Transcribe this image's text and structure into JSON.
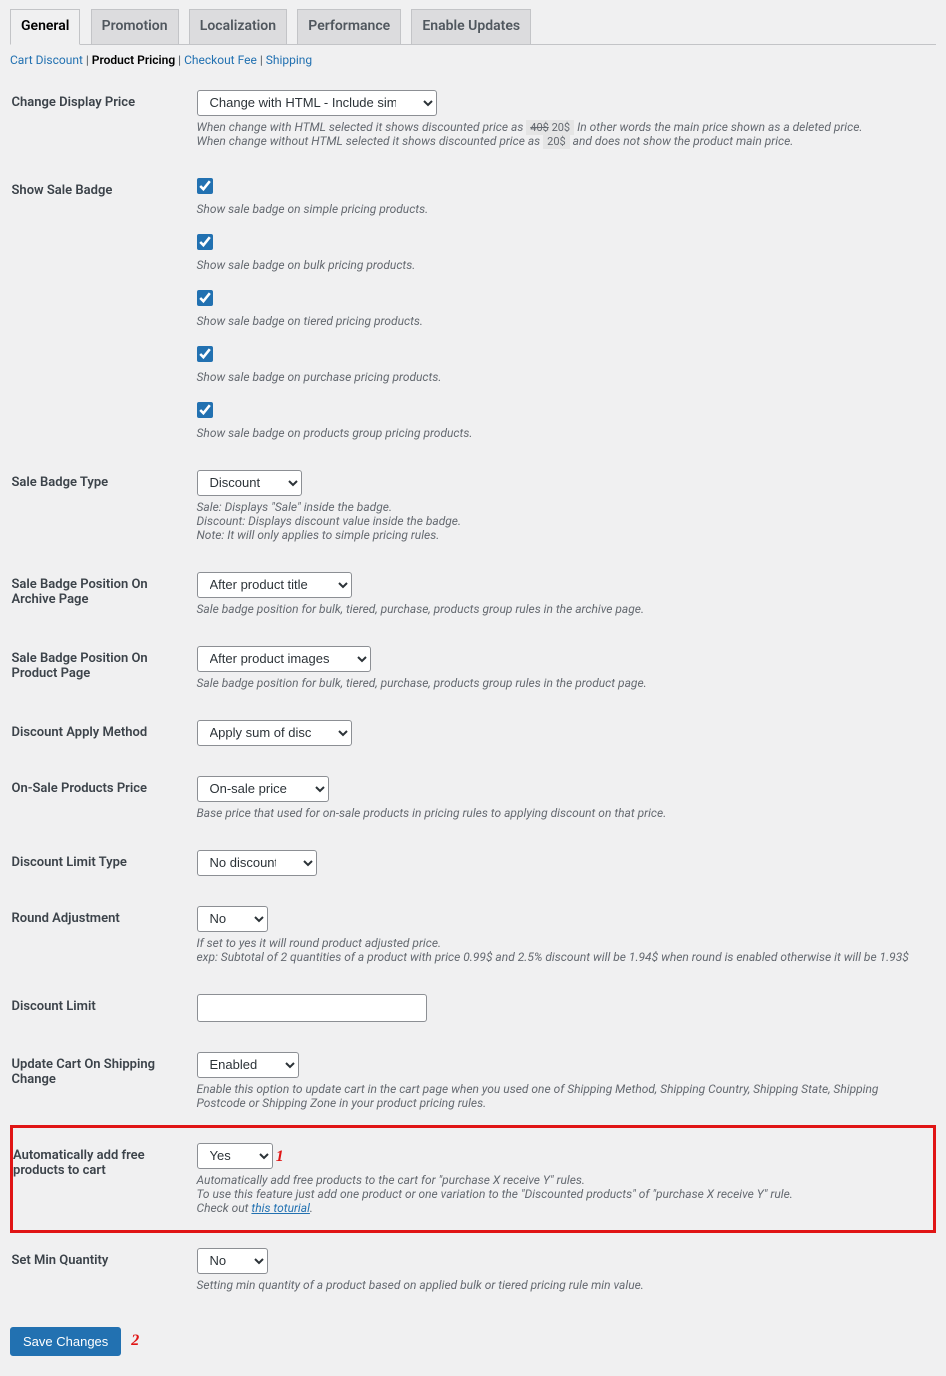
{
  "tabs": [
    {
      "label": "General",
      "active": true
    },
    {
      "label": "Promotion"
    },
    {
      "label": "Localization"
    },
    {
      "label": "Performance"
    },
    {
      "label": "Enable Updates"
    }
  ],
  "subtabs": {
    "cart_discount": "Cart Discount",
    "product_pricing": "Product Pricing",
    "checkout_fee": "Checkout Fee",
    "shipping": "Shipping",
    "sep": " | "
  },
  "change_display_price": {
    "label": "Change Display Price",
    "value": "Change with HTML - Include simple adjustments",
    "desc1_a": "When change with HTML selected it shows discounted price as ",
    "desc1_badge_strike": "40$",
    "desc1_badge_val": "20$",
    "desc1_c": " In other words the main price shown as a deleted price.",
    "desc2_a": "When change without HTML selected it shows discounted price as ",
    "desc2_badge": "20$",
    "desc2_c": " and does not show the product main price."
  },
  "show_sale_badge": {
    "label": "Show Sale Badge",
    "cb1": "Show sale badge on simple pricing products.",
    "cb2": "Show sale badge on bulk pricing products.",
    "cb3": "Show sale badge on tiered pricing products.",
    "cb4": "Show sale badge on purchase pricing products.",
    "cb5": "Show sale badge on products group pricing products."
  },
  "sale_badge_type": {
    "label": "Sale Badge Type",
    "value": "Discount",
    "desc1": "Sale: Displays \"Sale\" inside the badge.",
    "desc2": "Discount: Displays discount value inside the badge.",
    "desc3": "Note: It will only applies to simple pricing rules."
  },
  "sale_badge_pos_archive": {
    "label": "Sale Badge Position On Archive Page",
    "value": "After product title",
    "desc": "Sale badge position for bulk, tiered, purchase, products group rules in the archive page."
  },
  "sale_badge_pos_product": {
    "label": "Sale Badge Position On Product Page",
    "value": "After product images",
    "desc": "Sale badge position for bulk, tiered, purchase, products group rules in the product page."
  },
  "discount_apply_method": {
    "label": "Discount Apply Method",
    "value": "Apply sum of discounts"
  },
  "onsale_products_price": {
    "label": "On-Sale Products Price",
    "value": "On-sale price",
    "desc": "Base price that used for on-sale products in pricing rules to applying discount on that price."
  },
  "discount_limit_type": {
    "label": "Discount Limit Type",
    "value": "No discount limit"
  },
  "round_adjustment": {
    "label": "Round Adjustment",
    "value": "No",
    "desc1": "If set to yes it will round product adjusted price.",
    "desc2": "exp: Subtotal of 2 quantities of a product with price 0.99$ and 2.5% discount will be 1.94$ when round is enabled otherwise it will be 1.93$"
  },
  "discount_limit": {
    "label": "Discount Limit"
  },
  "update_cart_shipping": {
    "label": "Update Cart On Shipping Change",
    "value": "Enabled",
    "desc": "Enable this option to update cart in the cart page when you used one of Shipping Method, Shipping Country, Shipping State, Shipping Postcode or Shipping Zone in your product pricing rules."
  },
  "auto_add_free": {
    "label": "Automatically add free products to cart",
    "value": "Yes",
    "desc1": "Automatically add free products to the cart for \"purchase X receive Y\" rules.",
    "desc2": "To use this feature just add one product or one variation to the \"Discounted products\" of \"purchase X receive Y\" rule.",
    "desc3_a": "Check out ",
    "desc3_link": "this toturial",
    "desc3_b": "."
  },
  "set_min_qty": {
    "label": "Set Min Quantity",
    "value": "No",
    "desc": "Setting min quantity of a product based on applied bulk or tiered pricing rule min value."
  },
  "save_button": "Save Changes",
  "annotations": {
    "a1": "1",
    "a2": "2"
  }
}
